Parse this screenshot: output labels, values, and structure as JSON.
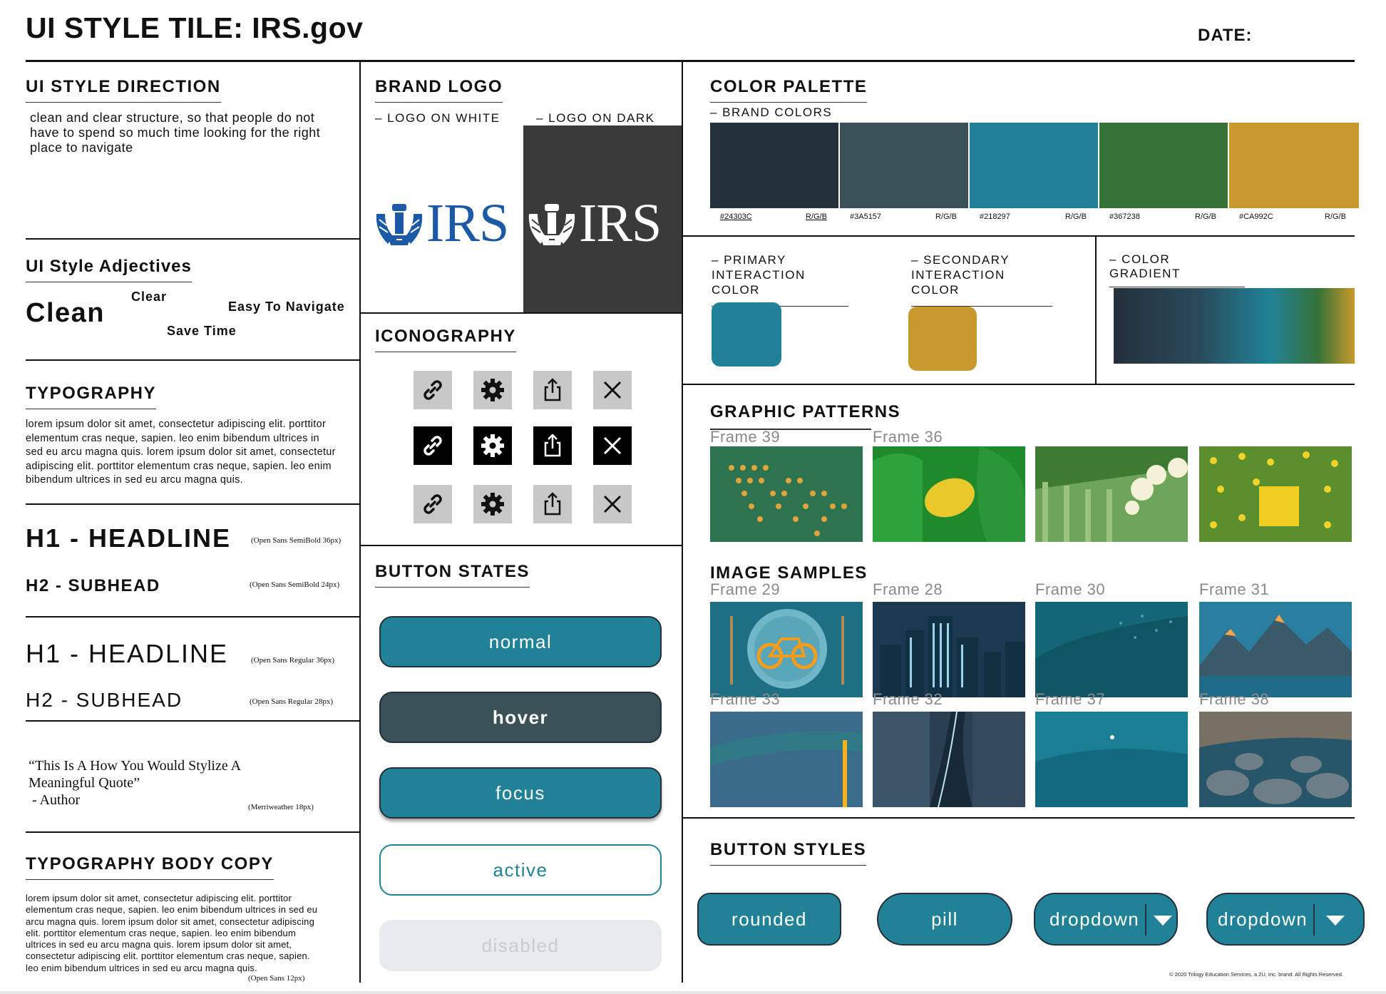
{
  "page": {
    "title": "UI STYLE TILE: IRS.gov",
    "date_label": "DATE:",
    "copyright": "© 2020 Trilogy Education Services, a 2U, Inc. brand. All Rights Reserved."
  },
  "direction": {
    "title": "UI STYLE DIRECTION",
    "text": "clean and clear structure, so that people do not have to spend so much time looking for the right place to navigate"
  },
  "adjectives": {
    "title": "UI Style Adjectives",
    "clean": "Clean",
    "clear": "Clear",
    "easy": "Easy To Navigate",
    "save": "Save Time"
  },
  "typography": {
    "title": "TYPOGRAPHY",
    "body": "lorem ipsum dolor sit amet, consectetur adipiscing elit. porttitor elementum cras neque, sapien. leo enim bibendum ultrices in sed eu arcu magna quis. lorem ipsum dolor sit amet, consectetur adipiscing elit. porttitor elementum cras neque, sapien. leo enim bibendum ultrices in sed eu arcu magna quis.",
    "h1_semibold": "H1 - HEADLINE",
    "h1_semibold_note": "(Open Sans SemiBold 36px)",
    "h2_semibold": "H2 - SUBHEAD",
    "h2_semibold_note": "(Open Sans SemiBold 24px)",
    "h1_regular": "H1 - HEADLINE",
    "h1_regular_note": "(Open Sans Regular 36px)",
    "h2_regular": "H2 - SUBHEAD",
    "h2_regular_note": "(Open Sans Regular 28px)",
    "quote_line1": "“This Is A How You Would Stylize A",
    "quote_line2": "Meaningful Quote”",
    "quote_author": " - Author",
    "quote_note": "(Merriweather 18px)"
  },
  "body_copy": {
    "title": "TYPOGRAPHY BODY COPY",
    "text": "lorem ipsum dolor sit amet, consectetur adipiscing elit. porttitor elementum cras neque, sapien. leo enim bibendum ultrices in sed eu arcu magna quis. lorem ipsum dolor sit amet, consectetur adipiscing elit. porttitor elementum cras neque, sapien. leo enim bibendum ultrices in sed eu arcu magna quis. lorem ipsum dolor sit amet, consectetur adipiscing elit. porttitor elementum cras neque, sapien. leo enim bibendum ultrices in sed eu arcu magna quis.",
    "note": "(Open Sans 12px)"
  },
  "logo": {
    "title": "BRAND LOGO",
    "on_white": "– LOGO ON WHITE",
    "on_dark": "– LOGO ON DARK",
    "wordmark": "IRS",
    "blue": "#1c5aa8",
    "dark_bg": "#3a3a3a"
  },
  "iconography": {
    "title": "ICONOGRAPHY",
    "icons": [
      "link-icon",
      "gear-icon",
      "share-icon",
      "close-icon"
    ]
  },
  "button_states": {
    "title": "BUTTON STATES",
    "normal": "normal",
    "hover": "hover",
    "focus": "focus",
    "active": "active",
    "disabled": "disabled"
  },
  "palette": {
    "title": "COLOR PALETTE",
    "brand_label": "– BRAND COLORS",
    "rgb_label": "R/G/B",
    "colors": [
      {
        "hex": "#24303C"
      },
      {
        "hex": "#3A5157"
      },
      {
        "hex": "#218297"
      },
      {
        "hex": "#367238"
      },
      {
        "hex": "#CA992C"
      }
    ],
    "primary_label_1": "– PRIMARY",
    "primary_label_2": "INTERACTION COLOR",
    "secondary_label_1": "– SECONDARY",
    "secondary_label_2": "INTERACTION COLOR",
    "gradient_label": "– COLOR GRADIENT"
  },
  "patterns": {
    "title": "GRAPHIC PATTERNS",
    "frames": [
      "Frame 39",
      "Frame 36"
    ]
  },
  "samples": {
    "title": "IMAGE SAMPLES",
    "frames_row1": [
      "Frame 29",
      "Frame 28",
      "Frame 30",
      "Frame 31"
    ],
    "frames_row2": [
      "Frame 33",
      "Frame 32",
      "Frame 37",
      "Frame 38"
    ]
  },
  "button_styles": {
    "title": "BUTTON STYLES",
    "rounded": "rounded",
    "pill": "pill",
    "dropdown1": "dropdown",
    "dropdown2": "dropdown"
  }
}
